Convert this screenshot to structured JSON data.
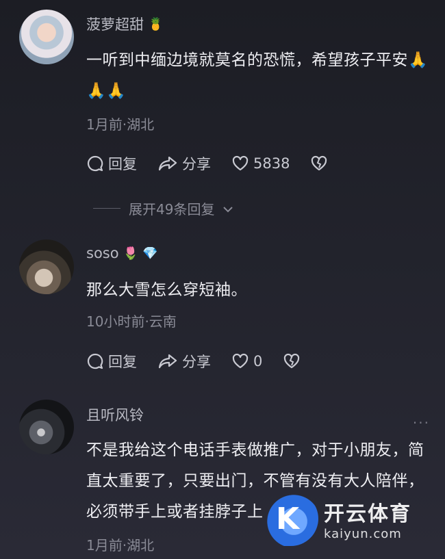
{
  "comments": [
    {
      "username": "菠萝超甜",
      "badges": [
        "🍍"
      ],
      "text": "一听到中缅边境就莫名的恐慌，希望孩子平安🙏🙏🙏",
      "meta": "1月前·湖北",
      "reply_label": "回复",
      "share_label": "分享",
      "likes": "5838",
      "expand_label": "展开49条回复"
    },
    {
      "username": "soso",
      "badges": [
        "🌷",
        "💎"
      ],
      "text": "那么大雪怎么穿短袖。",
      "meta": "10小时前·云南",
      "reply_label": "回复",
      "share_label": "分享",
      "likes": "0"
    },
    {
      "username": "且听风铃",
      "badges": [],
      "more": "···",
      "text": "不是我给这个电话手表做推广，对于小朋友，简直太重要了，只要出门，不管有没有大人陪伴，必须带手上或者挂脖子上",
      "meta": "1月前·湖北"
    }
  ],
  "watermark": {
    "title": "开云体育",
    "subtitle": "kaiyun.com"
  },
  "colors": {
    "background": "#1c1d24",
    "text": "#eeeef2",
    "muted": "#8a8b96"
  }
}
